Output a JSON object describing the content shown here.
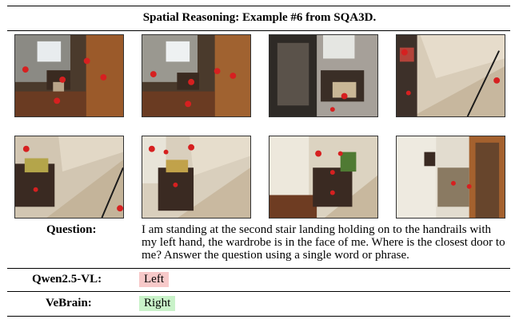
{
  "header": {
    "title": "Spatial Reasoning: Example #6 from SQA3D."
  },
  "images": {
    "row1": [
      {
        "name": "frame-1",
        "marks": [
          "11",
          "26",
          "19",
          "48",
          "10",
          "13"
        ]
      },
      {
        "name": "frame-2",
        "marks": [
          "11",
          "26",
          "19",
          "48",
          "10",
          "13"
        ]
      },
      {
        "name": "frame-3",
        "marks": [
          "10",
          "19"
        ]
      },
      {
        "name": "frame-4",
        "marks": [
          "80",
          "9",
          "11"
        ]
      }
    ],
    "row2": [
      {
        "name": "frame-5",
        "marks": [
          "0",
          "9",
          "11"
        ]
      },
      {
        "name": "frame-6",
        "marks": [
          "28",
          "5",
          "0",
          "80",
          "6"
        ]
      },
      {
        "name": "frame-7",
        "marks": [
          "21",
          "15",
          "8",
          "0"
        ]
      },
      {
        "name": "frame-8",
        "marks": [
          "5",
          "01"
        ]
      }
    ]
  },
  "question": {
    "label": "Question:",
    "text": "I am standing at the second stair landing holding on to the handrails with my left hand, the wardrobe is in the face of me. Where is the closest door to me? Answer the question using a single word or phrase."
  },
  "answers": [
    {
      "model": "Qwen2.5-VL:",
      "answer": "Left",
      "status": "wrong"
    },
    {
      "model": "VeBrain:",
      "answer": "Right",
      "status": "correct"
    }
  ],
  "colors": {
    "wrong_highlight": "#f7c9c9",
    "correct_highlight": "#c9f2c9",
    "marker_red": "#d62020"
  }
}
